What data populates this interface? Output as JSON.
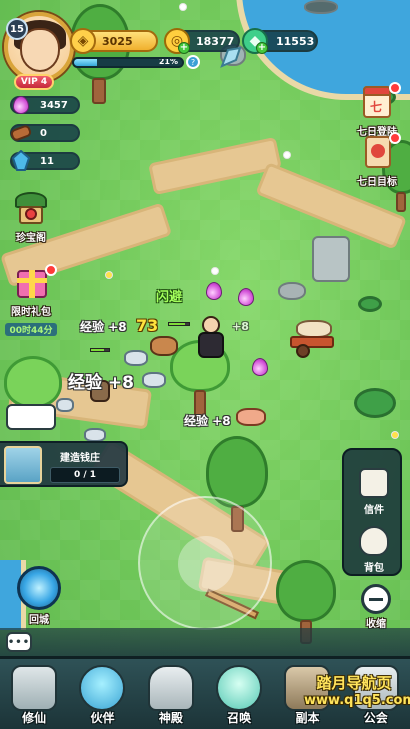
{
  "player": {
    "level": "15",
    "vip": "VIP 4",
    "exp_percent_text": "21%",
    "exp_fraction": 0.21
  },
  "currencies": {
    "gold": "3025",
    "coins": "18377",
    "jade": "11553"
  },
  "resources": [
    {
      "icon": "purple-soul-icon",
      "value": "3457"
    },
    {
      "icon": "wood-log-icon",
      "value": "0"
    },
    {
      "icon": "blue-crystal-icon",
      "value": "11"
    }
  ],
  "left_buttons": {
    "treasure_pavilion": "珍宝阁",
    "limited_gift": "限时礼包",
    "limited_gift_timer": "00时44分",
    "return_city": "回城"
  },
  "right_buttons": {
    "seven_day_login": "七日登陆",
    "seven_day_goal": "七日目标",
    "mail": "信件",
    "backpack": "背包",
    "collapse": "收缩"
  },
  "build_panel": {
    "title": "建造钱庄",
    "progress": "0 / 1"
  },
  "floating": {
    "exp_small_1": "经验 +8",
    "exp_big": "经验 +8",
    "exp_small_2": "经验 +8",
    "dodge": "闪避",
    "damage": "73",
    "plus8": "+8"
  },
  "chat": {
    "icon": "chat-bubble-icon"
  },
  "bottom_nav": [
    {
      "label": "修仙",
      "icon": "cultivation-scroll-icon"
    },
    {
      "label": "伙伴",
      "icon": "partner-character-icon"
    },
    {
      "label": "神殿",
      "icon": "temple-icon"
    },
    {
      "label": "召唤",
      "icon": "summon-spirit-icon"
    },
    {
      "label": "副本",
      "icon": "dungeon-gate-icon"
    },
    {
      "label": "公会",
      "icon": "guild-hall-icon"
    }
  ],
  "watermark": {
    "line1": "踏月导航页",
    "line2": "www.q1q5.com"
  },
  "colors": {
    "grass": "#72c95b",
    "path": "#e6c792",
    "water": "#3fa6dd",
    "hud_dark": "#1c3b40",
    "gold": "#f0b02e"
  }
}
